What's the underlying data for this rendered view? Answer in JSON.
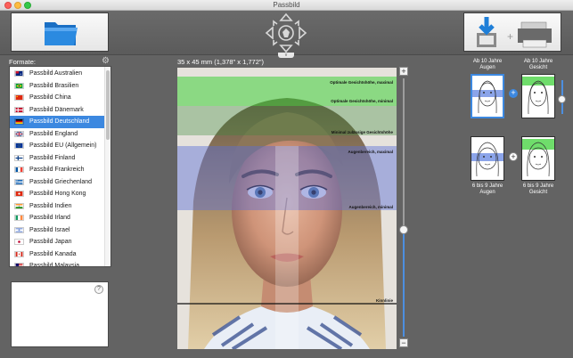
{
  "window": {
    "title": "Passbild"
  },
  "sidebar": {
    "label": "Formate:",
    "items": [
      {
        "label": "Passbild Australien",
        "flag": "australia-flag"
      },
      {
        "label": "Passbild Brasilien",
        "flag": "brazil-flag"
      },
      {
        "label": "Passbild China",
        "flag": "china-flag"
      },
      {
        "label": "Passbild Dänemark",
        "flag": "denmark-flag"
      },
      {
        "label": "Passbild Deutschland",
        "flag": "germany-flag",
        "selected": true
      },
      {
        "label": "Passbild England",
        "flag": "uk-flag"
      },
      {
        "label": "Passbild EU (Allgemein)",
        "flag": "eu-flag"
      },
      {
        "label": "Passbild Finland",
        "flag": "finland-flag"
      },
      {
        "label": "Passbild Frankreich",
        "flag": "france-flag"
      },
      {
        "label": "Passbild Griechenland",
        "flag": "greece-flag"
      },
      {
        "label": "Passbild Hong Kong",
        "flag": "hongkong-flag"
      },
      {
        "label": "Passbild Indien",
        "flag": "india-flag"
      },
      {
        "label": "Passbild Irland",
        "flag": "ireland-flag"
      },
      {
        "label": "Passbild Israel",
        "flag": "israel-flag"
      },
      {
        "label": "Passbild Japan",
        "flag": "japan-flag"
      },
      {
        "label": "Passbild Kanada",
        "flag": "canada-flag"
      },
      {
        "label": "Passbild Malaysia",
        "flag": "malaysia-flag"
      }
    ],
    "help_label": "?"
  },
  "toolbar": {
    "nav_tab_label": "v"
  },
  "main": {
    "dimension_label": "35 x 45 mm (1,378\" x 1,772\")",
    "guides": {
      "face_max": "Optimale Gesichtshöhe, maximal",
      "face_min": "Optimale Gesichtshöhe, minimal",
      "face_min_allowed": "Minimal zulässige Gesichtshöhe",
      "eye_max": "Augenbereich, maximal",
      "eye_min": "Augenbereich, minimal",
      "chin": "Kinnlinie"
    },
    "zoom": {
      "plus": "+",
      "minus": "−",
      "level": 0.58
    }
  },
  "right_panel": {
    "top_left_label": "Ab 10 Jahre\nAugen",
    "top_right_label": "Ab 10 Jahre\nGesicht",
    "bottom_left_label": "6 bis 9 Jahre\nAugen",
    "bottom_right_label": "6 bis 9 Jahre\nGesicht",
    "plus": "+"
  },
  "colors": {
    "selection": "#3c88e0",
    "face_band": "#3fd13a",
    "eye_band": "#5a6fd6"
  }
}
